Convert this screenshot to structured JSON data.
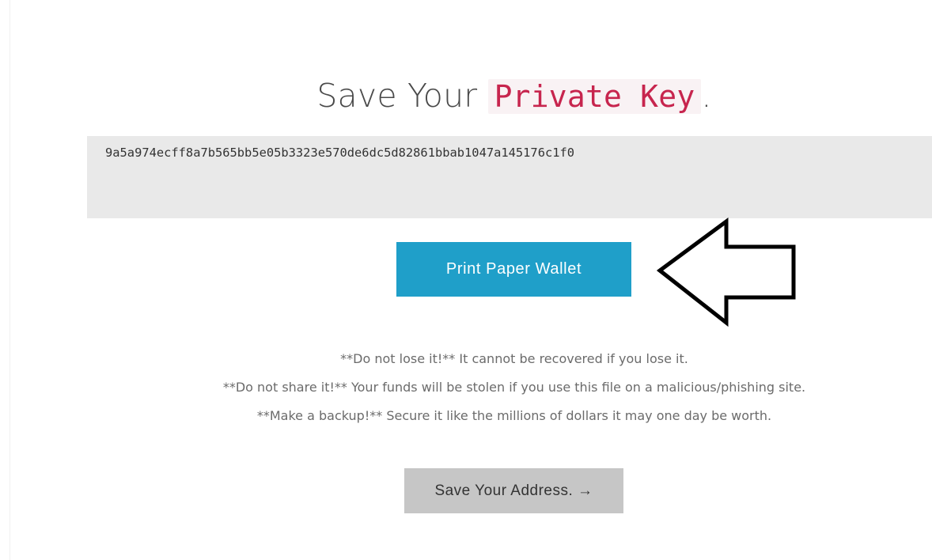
{
  "heading": {
    "prefix": "Save Your ",
    "code": "Private Key",
    "suffix": "."
  },
  "private_key": "9a5a974ecff8a7b565bb5e05b3323e570de6dc5d82861bbab1047a145176c1f0",
  "print_button": {
    "label": "Print Paper Wallet",
    "color": "#1f9fc9"
  },
  "annotation": {
    "icon": "left-arrow-icon"
  },
  "warnings": [
    "**Do not lose it!** It cannot be recovered if you lose it.",
    "**Do not share it!** Your funds will be stolen if you use this file on a malicious/phishing site.",
    "**Make a backup!** Secure it like the millions of dollars it may one day be worth."
  ],
  "address_button": {
    "label": "Save Your Address. →",
    "color": "#c6c6c6"
  },
  "colors": {
    "code_text": "#c7254e",
    "code_background": "#f9f2f4",
    "key_box": "#e9e9e9"
  }
}
